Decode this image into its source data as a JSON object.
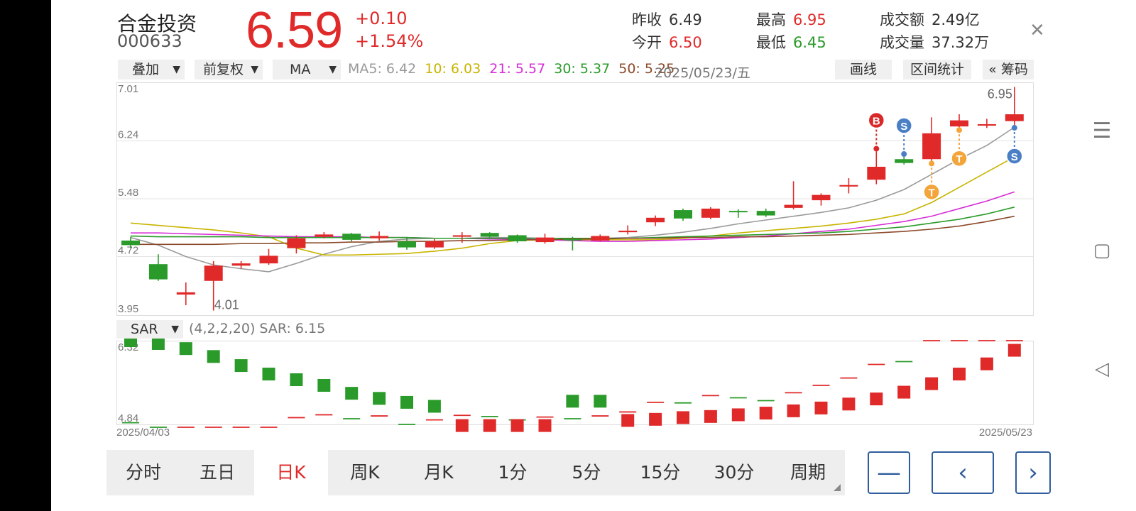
{
  "stock": {
    "name": "合金投资",
    "code": "000633",
    "price": "6.59",
    "change": "+0.10",
    "change_pct": "+1.54%"
  },
  "stats": {
    "prev_close_label": "昨收",
    "prev_close": "6.49",
    "open_label": "今开",
    "open": "6.50",
    "high_label": "最高",
    "high": "6.95",
    "low_label": "最低",
    "low": "6.45",
    "turnover_label": "成交额",
    "turnover": "2.49亿",
    "volume_label": "成交量",
    "volume": "37.32万"
  },
  "toolbar": {
    "overlay": "叠加",
    "adjust": "前复权",
    "indicator": "MA",
    "ma5": "MA5: 6.42",
    "ma10": "10: 6.03",
    "ma21": "21: 5.57",
    "ma30": "30: 5.37",
    "ma50": "50: 5.25",
    "date": "2025/05/23/五",
    "draw": "画线",
    "range_stats": "区间统计",
    "chips": "« 筹码"
  },
  "sar": {
    "label": "SAR",
    "params": "(4,2,2,20) SAR: 6.15"
  },
  "tabs": [
    "分时",
    "五日",
    "日K",
    "周K",
    "月K",
    "1分",
    "5分",
    "15分",
    "30分",
    "周期"
  ],
  "active_tab": 2,
  "nav_buttons": {
    "minus": "—",
    "prev": "‹",
    "next": "›"
  },
  "colors": {
    "up": "#e02a2a",
    "down": "#2a9b2a",
    "ma5": "#9a9a9a",
    "ma10": "#c8b400",
    "ma21": "#d62ed6",
    "ma30": "#2a9b2a",
    "ma50": "#8b4a2a",
    "accent": "#2f5d9b"
  },
  "chart_data": [
    {
      "type": "candlestick",
      "title": "",
      "y_ticks": [
        "7.01",
        "6.24",
        "5.48",
        "4.72",
        "3.95"
      ],
      "ylim": [
        3.95,
        7.01
      ],
      "annotations": {
        "max_label": "6.95",
        "min_label": "4.01"
      },
      "candles": [
        {
          "o": 4.93,
          "c": 4.87,
          "h": 4.98,
          "l": 4.83
        },
        {
          "o": 4.62,
          "c": 4.42,
          "h": 4.75,
          "l": 4.4
        },
        {
          "o": 4.22,
          "c": 4.25,
          "h": 4.38,
          "l": 4.08
        },
        {
          "o": 4.4,
          "c": 4.6,
          "h": 4.66,
          "l": 4.01
        },
        {
          "o": 4.6,
          "c": 4.63,
          "h": 4.66,
          "l": 4.56
        },
        {
          "o": 4.63,
          "c": 4.73,
          "h": 4.82,
          "l": 4.61
        },
        {
          "o": 4.83,
          "c": 4.96,
          "h": 5.0,
          "l": 4.76
        },
        {
          "o": 4.98,
          "c": 5.01,
          "h": 5.04,
          "l": 4.96
        },
        {
          "o": 5.02,
          "c": 4.94,
          "h": 5.03,
          "l": 4.92
        },
        {
          "o": 4.96,
          "c": 4.99,
          "h": 5.05,
          "l": 4.93
        },
        {
          "o": 4.92,
          "c": 4.84,
          "h": 4.97,
          "l": 4.81
        },
        {
          "o": 4.84,
          "c": 4.92,
          "h": 4.95,
          "l": 4.82
        },
        {
          "o": 4.98,
          "c": 5.0,
          "h": 5.04,
          "l": 4.9
        },
        {
          "o": 5.03,
          "c": 4.98,
          "h": 5.04,
          "l": 4.95
        },
        {
          "o": 5.0,
          "c": 4.92,
          "h": 5.01,
          "l": 4.9
        },
        {
          "o": 4.91,
          "c": 4.97,
          "h": 5.02,
          "l": 4.89
        },
        {
          "o": 4.95,
          "c": 4.94,
          "h": 4.98,
          "l": 4.8
        },
        {
          "o": 4.93,
          "c": 4.99,
          "h": 5.01,
          "l": 4.92
        },
        {
          "o": 5.04,
          "c": 5.06,
          "h": 5.13,
          "l": 5.01
        },
        {
          "o": 5.17,
          "c": 5.23,
          "h": 5.26,
          "l": 5.12
        },
        {
          "o": 5.33,
          "c": 5.22,
          "h": 5.35,
          "l": 5.19
        },
        {
          "o": 5.23,
          "c": 5.35,
          "h": 5.37,
          "l": 5.21
        },
        {
          "o": 5.32,
          "c": 5.31,
          "h": 5.34,
          "l": 5.23
        },
        {
          "o": 5.32,
          "c": 5.26,
          "h": 5.35,
          "l": 5.24
        },
        {
          "o": 5.36,
          "c": 5.4,
          "h": 5.71,
          "l": 5.34
        },
        {
          "o": 5.46,
          "c": 5.53,
          "h": 5.55,
          "l": 5.39
        },
        {
          "o": 5.64,
          "c": 5.66,
          "h": 5.75,
          "l": 5.55
        },
        {
          "o": 5.73,
          "c": 5.9,
          "h": 6.1,
          "l": 5.67
        },
        {
          "o": 6.0,
          "c": 5.95,
          "h": 6.03,
          "l": 5.93
        },
        {
          "o": 6.0,
          "c": 6.34,
          "h": 6.55,
          "l": 5.98
        },
        {
          "o": 6.43,
          "c": 6.51,
          "h": 6.59,
          "l": 6.42
        },
        {
          "o": 6.44,
          "c": 6.46,
          "h": 6.53,
          "l": 6.41
        },
        {
          "o": 6.5,
          "c": 6.59,
          "h": 6.95,
          "l": 6.45
        }
      ],
      "ma": {
        "ma5": [
          4.97,
          4.87,
          4.72,
          4.61,
          4.56,
          4.52,
          4.63,
          4.75,
          4.85,
          4.92,
          4.95,
          4.96,
          4.96,
          4.97,
          4.97,
          4.96,
          4.96,
          4.96,
          4.97,
          5.0,
          5.04,
          5.09,
          5.15,
          5.2,
          5.25,
          5.3,
          5.36,
          5.46,
          5.6,
          5.8,
          6.0,
          6.18,
          6.42
        ],
        "ma10": [
          5.16,
          5.13,
          5.1,
          5.07,
          5.03,
          4.98,
          4.83,
          4.74,
          4.74,
          4.75,
          4.76,
          4.79,
          4.83,
          4.89,
          4.93,
          4.94,
          4.94,
          4.94,
          4.94,
          4.94,
          4.96,
          4.99,
          5.03,
          5.06,
          5.09,
          5.12,
          5.16,
          5.21,
          5.28,
          5.43,
          5.63,
          5.83,
          6.03
        ],
        "ma21": [
          5.03,
          5.03,
          5.02,
          5.01,
          5.0,
          4.99,
          4.98,
          4.98,
          4.98,
          4.97,
          4.97,
          4.96,
          4.96,
          4.95,
          4.95,
          4.94,
          4.93,
          4.92,
          4.92,
          4.93,
          4.94,
          4.95,
          4.97,
          4.99,
          5.02,
          5.05,
          5.08,
          5.13,
          5.18,
          5.25,
          5.35,
          5.45,
          5.57
        ],
        "ma30": [
          4.99,
          4.98,
          4.98,
          4.98,
          4.98,
          4.97,
          4.97,
          4.97,
          4.97,
          4.97,
          4.97,
          4.96,
          4.96,
          4.96,
          4.96,
          4.96,
          4.96,
          4.96,
          4.96,
          4.97,
          4.98,
          4.99,
          5.0,
          5.01,
          5.02,
          5.03,
          5.05,
          5.08,
          5.11,
          5.16,
          5.21,
          5.28,
          5.37
        ],
        "ma50": [
          4.88,
          4.88,
          4.88,
          4.88,
          4.89,
          4.89,
          4.9,
          4.9,
          4.91,
          4.91,
          4.92,
          4.92,
          4.93,
          4.93,
          4.94,
          4.94,
          4.95,
          4.95,
          4.96,
          4.96,
          4.97,
          4.97,
          4.98,
          4.98,
          4.99,
          5.0,
          5.01,
          5.03,
          5.05,
          5.08,
          5.12,
          5.18,
          5.25
        ]
      },
      "signals": [
        {
          "index": 27,
          "mark": "B",
          "position": "above"
        },
        {
          "index": 28,
          "mark": "S",
          "position": "above"
        },
        {
          "index": 29,
          "mark": "T",
          "position": "below"
        },
        {
          "index": 30,
          "mark": "T",
          "position": "below"
        },
        {
          "index": 32,
          "mark": "S",
          "position": "below"
        }
      ]
    },
    {
      "type": "sar",
      "y_ticks": [
        "6.32",
        "4.84"
      ],
      "ylim": [
        4.84,
        6.32
      ],
      "x_labels": [
        "2025/04/03",
        "2025/05/23"
      ],
      "sar": [
        {
          "v": 6.32,
          "up": false
        },
        {
          "v": 6.27,
          "up": false
        },
        {
          "v": 6.18,
          "up": false
        },
        {
          "v": 6.04,
          "up": false
        },
        {
          "v": 5.88,
          "up": false
        },
        {
          "v": 5.73,
          "up": false
        },
        {
          "v": 5.63,
          "up": false
        },
        {
          "v": 5.53,
          "up": false
        },
        {
          "v": 5.39,
          "up": false
        },
        {
          "v": 5.3,
          "up": false
        },
        {
          "v": 5.23,
          "up": false
        },
        {
          "v": 5.16,
          "up": false
        },
        {
          "v": 4.82,
          "up": true
        },
        {
          "v": 4.82,
          "up": true
        },
        {
          "v": 4.82,
          "up": true
        },
        {
          "v": 4.82,
          "up": true
        },
        {
          "v": 5.25,
          "up": false
        },
        {
          "v": 5.25,
          "up": false
        },
        {
          "v": 4.91,
          "up": true
        },
        {
          "v": 4.93,
          "up": true
        },
        {
          "v": 4.96,
          "up": true
        },
        {
          "v": 4.98,
          "up": true
        },
        {
          "v": 5.01,
          "up": true
        },
        {
          "v": 5.04,
          "up": true
        },
        {
          "v": 5.08,
          "up": true
        },
        {
          "v": 5.13,
          "up": true
        },
        {
          "v": 5.2,
          "up": true
        },
        {
          "v": 5.29,
          "up": true
        },
        {
          "v": 5.41,
          "up": true
        },
        {
          "v": 5.56,
          "up": true
        },
        {
          "v": 5.73,
          "up": true
        },
        {
          "v": 5.91,
          "up": true
        },
        {
          "v": 6.15,
          "up": true
        }
      ]
    }
  ]
}
